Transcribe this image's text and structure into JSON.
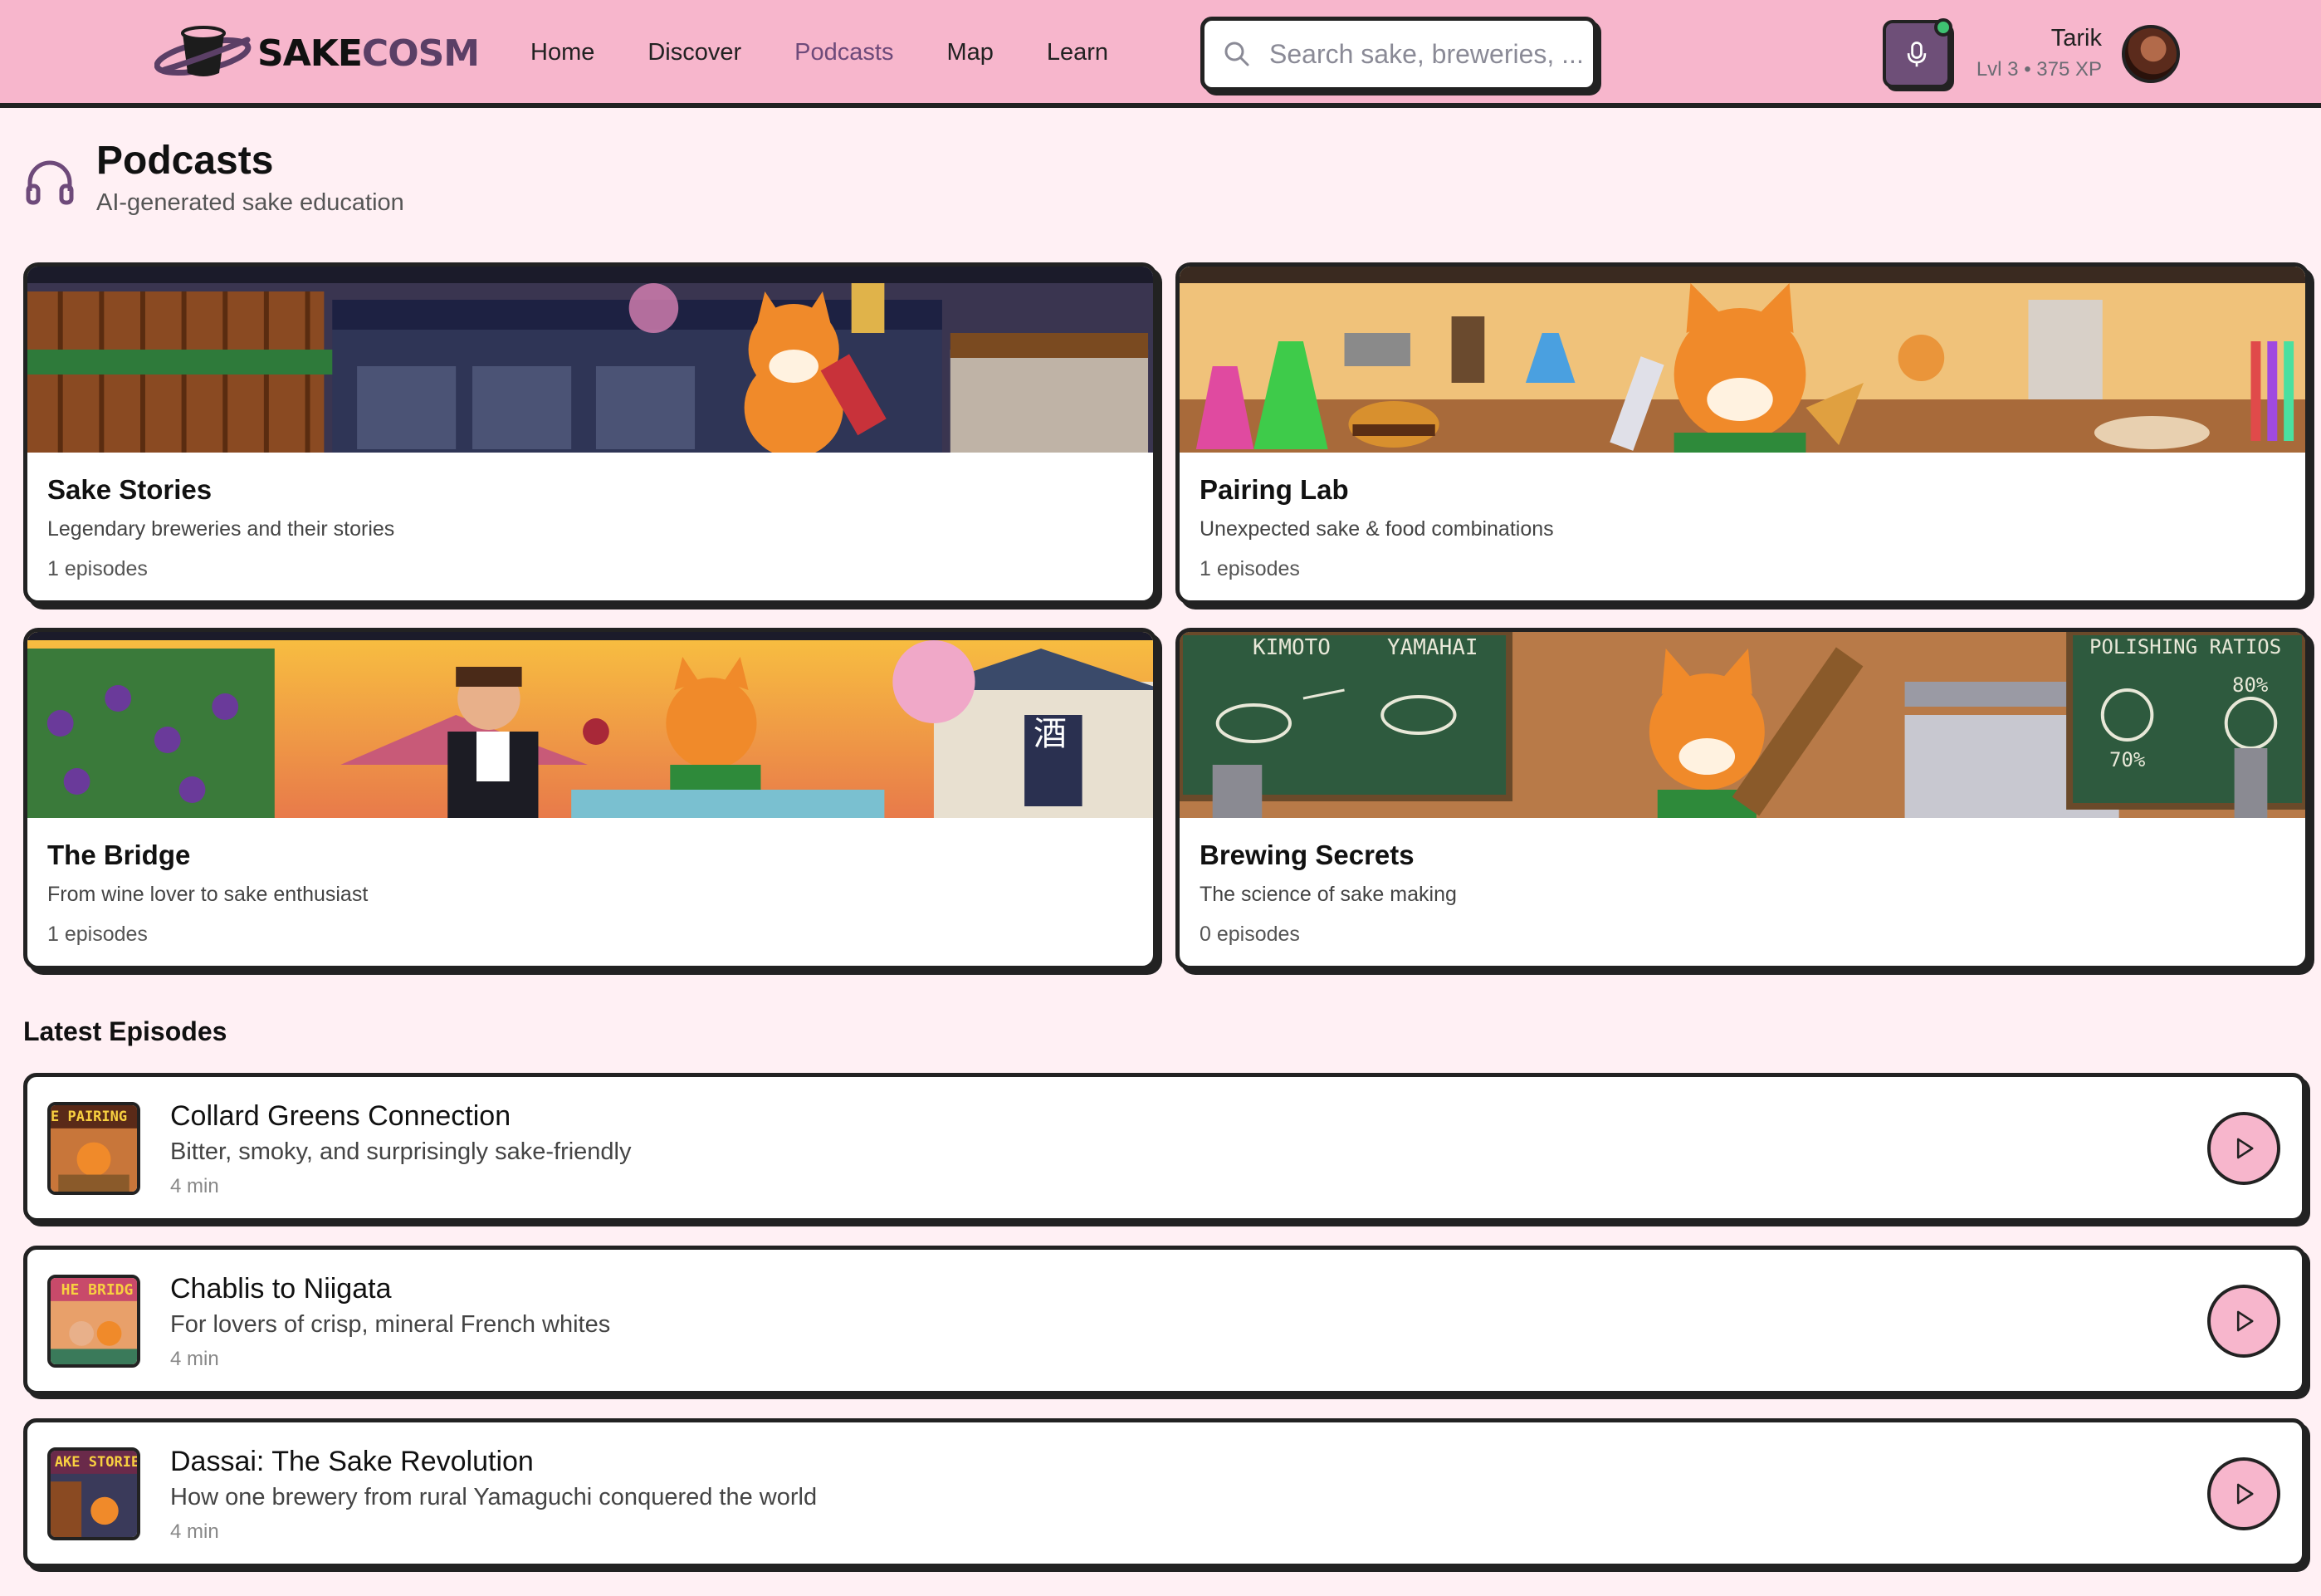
{
  "header": {
    "brand_prefix": "SAKE",
    "brand_suffix": "COSM",
    "nav": [
      {
        "label": "Home"
      },
      {
        "label": "Discover"
      },
      {
        "label": "Podcasts"
      },
      {
        "label": "Map"
      },
      {
        "label": "Learn"
      }
    ],
    "search": {
      "placeholder": "Search sake, breweries, ...",
      "value": ""
    },
    "user": {
      "name": "Tarik",
      "level": "Lvl 3 • 375 XP"
    }
  },
  "page": {
    "title": "Podcasts",
    "subtitle": "AI-generated sake education"
  },
  "podcasts": [
    {
      "title": "Sake Stories",
      "description": "Legendary breweries and their stories",
      "episodes": "1 episodes"
    },
    {
      "title": "Pairing Lab",
      "description": "Unexpected sake & food combinations",
      "episodes": "1 episodes"
    },
    {
      "title": "The Bridge",
      "description": "From wine lover to sake enthusiast",
      "episodes": "1 episodes"
    },
    {
      "title": "Brewing Secrets",
      "description": "The science of sake making",
      "episodes": "0 episodes"
    }
  ],
  "art_labels": {
    "kimoto": "KIMOTO",
    "yamahai": "YAMAHAI",
    "polishing": "POLISHING RATIOS",
    "pct1": "80%",
    "pct2": "70%",
    "kanji": "酒"
  },
  "latest": {
    "title": "Latest Episodes",
    "episodes": [
      {
        "title": "Collard Greens Connection",
        "description": "Bitter, smoky, and surprisingly sake-friendly",
        "duration": "4 min",
        "thumb_label": "E PAIRING L"
      },
      {
        "title": "Chablis to Niigata",
        "description": "For lovers of crisp, mineral French whites",
        "duration": "4 min",
        "thumb_label": "HE BRIDG"
      },
      {
        "title": "Dassai: The Sake Revolution",
        "description": "How one brewery from rural Yamaguchi conquered the world",
        "duration": "4 min",
        "thumb_label": "AKE STORIE"
      }
    ]
  },
  "colors": {
    "header_bg": "#f7b6cc",
    "page_bg": "#fff0f4",
    "accent_purple": "#6e4a7a",
    "outline": "#222222"
  },
  "icons": {
    "logo": "sake-cup-planet-logo",
    "search": "search-icon",
    "mic": "microphone-icon",
    "page": "headphones-icon",
    "play": "play-icon"
  }
}
